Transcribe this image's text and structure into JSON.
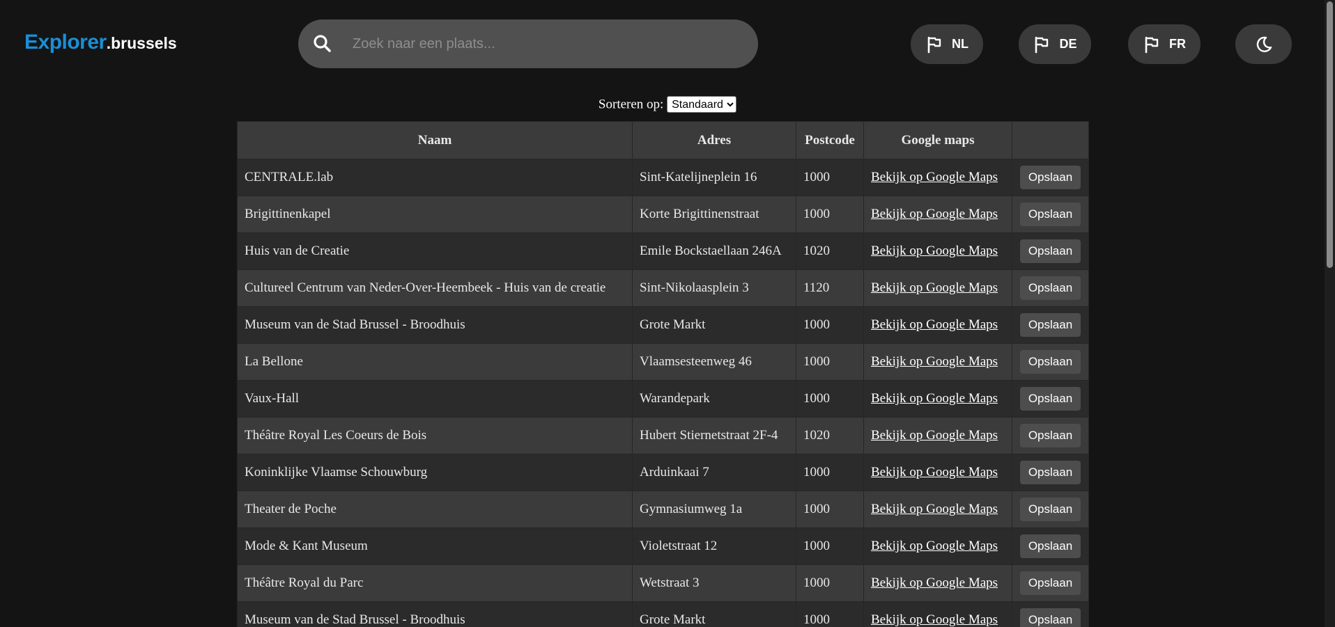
{
  "header": {
    "logo_main": "Explorer",
    "logo_suffix": ".brussels",
    "search_placeholder": "Zoek naar een plaats...",
    "languages": [
      "NL",
      "DE",
      "FR"
    ]
  },
  "sort": {
    "label": "Sorteren op:",
    "selected": "Standaard"
  },
  "table": {
    "columns": [
      "Naam",
      "Adres",
      "Postcode",
      "Google maps",
      ""
    ],
    "link_label": "Bekijk op Google Maps",
    "save_label": "Opslaan",
    "rows": [
      {
        "naam": "CENTRALE.lab",
        "adres": "Sint-Katelijneplein 16",
        "postcode": "1000"
      },
      {
        "naam": "Brigittinenkapel",
        "adres": "Korte Brigittinenstraat",
        "postcode": "1000"
      },
      {
        "naam": "Huis van de Creatie",
        "adres": "Emile Bockstaellaan 246A",
        "postcode": "1020"
      },
      {
        "naam": "Cultureel Centrum van Neder-Over-Heembeek - Huis van de creatie",
        "adres": "Sint-Nikolaasplein 3",
        "postcode": "1120"
      },
      {
        "naam": "Museum van de Stad Brussel - Broodhuis",
        "adres": "Grote Markt",
        "postcode": "1000"
      },
      {
        "naam": "La Bellone",
        "adres": "Vlaamsesteenweg 46",
        "postcode": "1000"
      },
      {
        "naam": "Vaux-Hall",
        "adres": "Warandepark",
        "postcode": "1000"
      },
      {
        "naam": "Théâtre Royal Les Coeurs de Bois",
        "adres": "Hubert Stiernetstraat 2F-4",
        "postcode": "1020"
      },
      {
        "naam": "Koninklijke Vlaamse Schouwburg",
        "adres": "Arduinkaai 7",
        "postcode": "1000"
      },
      {
        "naam": "Theater de Poche",
        "adres": "Gymnasiumweg 1a",
        "postcode": "1000"
      },
      {
        "naam": "Mode & Kant Museum",
        "adres": "Violetstraat 12",
        "postcode": "1000"
      },
      {
        "naam": "Théâtre Royal du Parc",
        "adres": "Wetstraat 3",
        "postcode": "1000"
      },
      {
        "naam": "Museum van de Stad Brussel - Broodhuis",
        "adres": "Grote Markt",
        "postcode": "1000"
      }
    ]
  }
}
